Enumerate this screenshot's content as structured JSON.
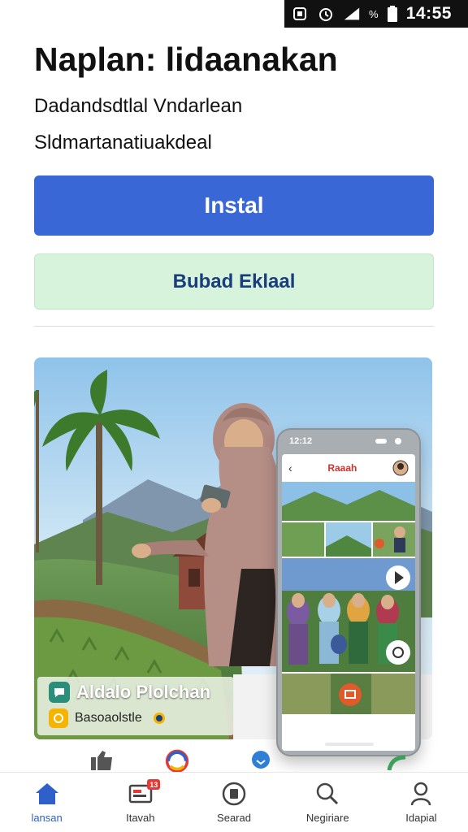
{
  "status_bar": {
    "time": "14:55",
    "battery_percent_symbol": "%"
  },
  "header": {
    "title": "Naplan: lidaanakan",
    "subtitle_1": "Dadandsdtlal Vndarlean",
    "subtitle_2": "Sldmartanatiuakdeal"
  },
  "buttons": {
    "install_label": "Instal",
    "secondary_label": "Bubad Eklaal"
  },
  "hero": {
    "caption_title": "Aldalo Plolchan",
    "caption_sub": "Basoaolstle"
  },
  "phone": {
    "status_time": "12:12",
    "screen_title": "Raaah"
  },
  "nav": {
    "items": [
      {
        "label": "lansan",
        "icon": "home-icon"
      },
      {
        "label": "Itavah",
        "icon": "video-icon",
        "badge": "13"
      },
      {
        "label": "Searad",
        "icon": "book-icon"
      },
      {
        "label": "Negiriare",
        "icon": "search-icon"
      },
      {
        "label": "Idapial",
        "icon": "person-icon"
      }
    ]
  },
  "colors": {
    "primary": "#3a67d6",
    "secondary_bg": "#d8f3dc",
    "active_nav": "#2f5fc9",
    "badge": "#e53935"
  }
}
